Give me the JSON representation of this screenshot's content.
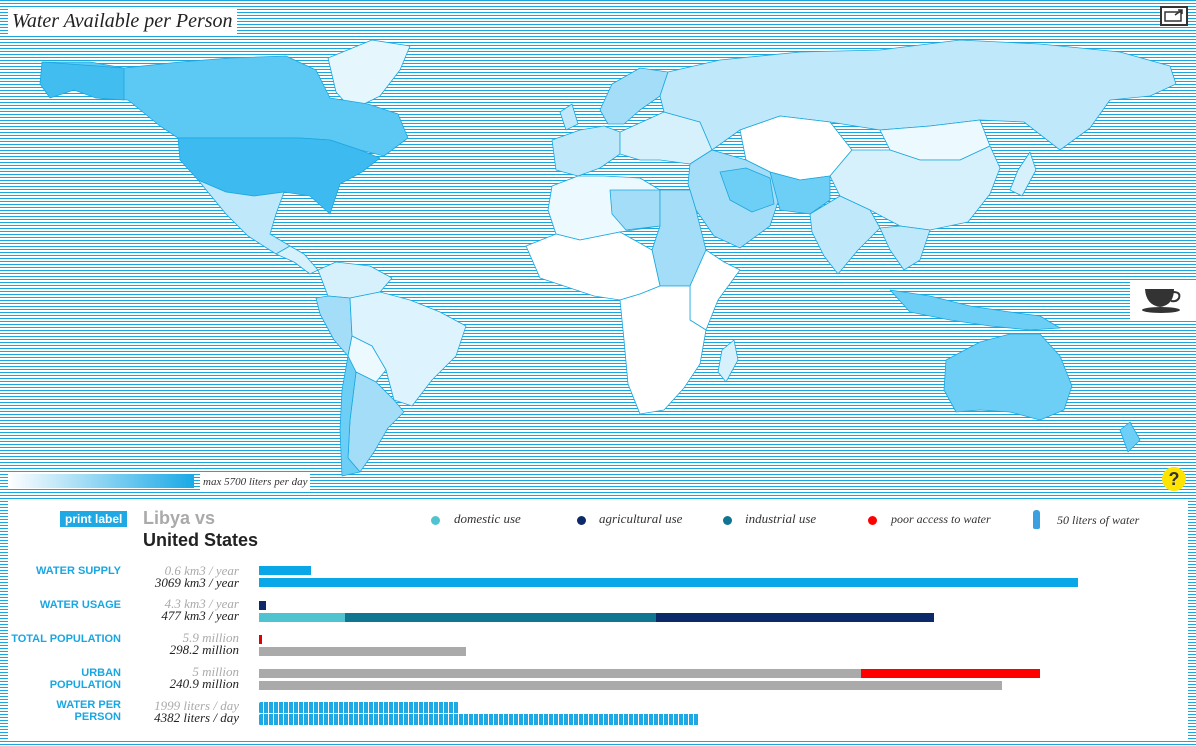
{
  "map": {
    "title": "Water Available per Person",
    "legend_max": "max 5700 liters per day",
    "legend_colors": {
      "low": "#ffffff",
      "high": "#19a9e6"
    },
    "ocean_color": "#1aa7df",
    "highlighted_countries": [
      "Libya",
      "United States"
    ],
    "icons": {
      "fullscreen": "fullscreen-icon",
      "cup": "coffee-cup-icon",
      "help": "help-icon"
    },
    "help_label": "?"
  },
  "panel": {
    "print_label": "print label",
    "country_a": "Libya vs",
    "country_b": "United States",
    "legend": [
      {
        "label": "domestic use",
        "color": "#4fc3cf"
      },
      {
        "label": "agricultural use",
        "color": "#0c2a6a"
      },
      {
        "label": "industrial use",
        "color": "#0f7590"
      },
      {
        "label": "poor access to water",
        "color": "#ff0000"
      },
      {
        "label": "50 liters of water",
        "color": "#3aa0e0",
        "icon": "water-bottle-icon"
      }
    ],
    "rows": [
      {
        "label": "WATER SUPPLY",
        "a": "0.6 km3 / year",
        "b": "3069 km3 / year"
      },
      {
        "label": "WATER USAGE",
        "a": "4.3 km3 / year",
        "b": "477 km3 / year"
      },
      {
        "label": "TOTAL POPULATION",
        "a": "5.9 million",
        "b": "298.2 million"
      },
      {
        "label": "URBAN POPULATION",
        "a": "5 million",
        "b": "240.9 million"
      },
      {
        "label": "WATER PER PERSON",
        "a": "1999 liters / day",
        "b": "4382 liters / day"
      }
    ]
  },
  "bars": {
    "water_supply": {
      "a": 0.064,
      "b": 1.0
    },
    "water_usage": {
      "a": 0.008,
      "b_segments": [
        {
          "use": "domestic",
          "fraction": 0.105,
          "color": "#4fc3cf"
        },
        {
          "use": "industrial",
          "fraction": 0.38,
          "color": "#0f7590"
        },
        {
          "use": "agricultural",
          "fraction": 0.34,
          "color": "#0c2a6a"
        }
      ]
    },
    "total_population": {
      "a": 0.004,
      "b": 0.253,
      "a_color": "#e00000",
      "b_color": "#aaaaaa"
    },
    "urban_population": {
      "a_total": 0.954,
      "a_poor_access": 0.218,
      "b": 0.907,
      "color": "#aaaaaa",
      "poor_color": "#ff0000"
    },
    "water_per_person": {
      "a_bottles": 40,
      "b_bottles": 88
    }
  }
}
